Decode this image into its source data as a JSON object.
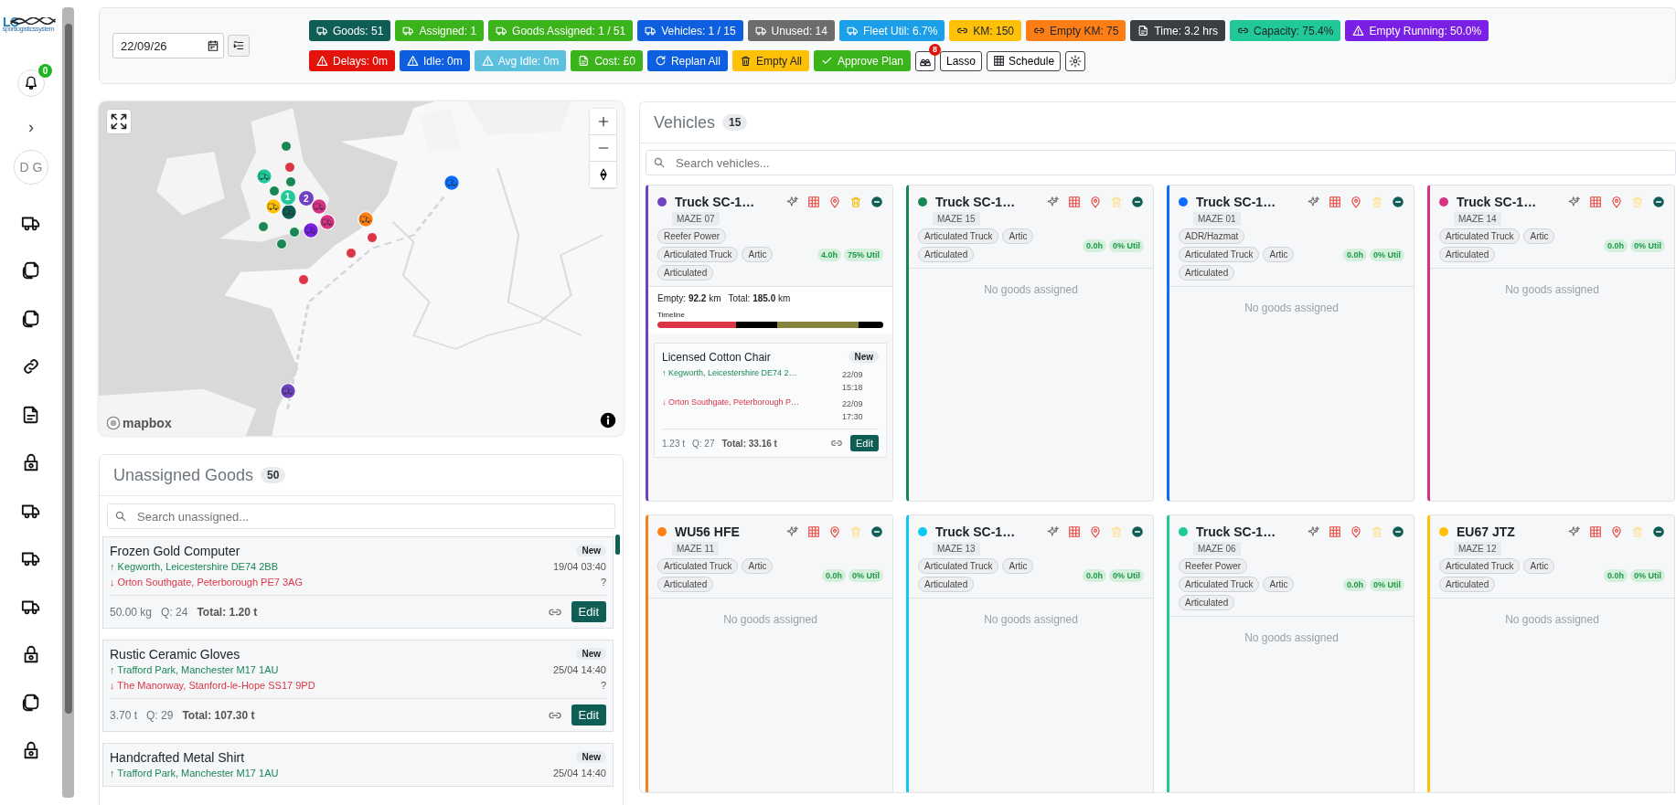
{
  "sidebar": {
    "logo": {
      "mark": "LS",
      "tagline": "sportlogisticssystem"
    },
    "notifications": "0",
    "expand": "›",
    "avatar": "D G"
  },
  "toolbar": {
    "date": "22/09/26",
    "summary": [
      {
        "kind": "vehicle",
        "label": "Goods: 51",
        "color": "#0f5e55",
        "dark_text": false
      },
      {
        "kind": "vehicle",
        "label": "Assigned: 1",
        "color": "#3bb31a",
        "dark_text": false
      },
      {
        "kind": "vehicle",
        "label": "Goods Assigned: 1 / 51",
        "color": "#3bb31a",
        "dark_text": false
      },
      {
        "kind": "vehicle",
        "label": "Vehicles: 1 / 15",
        "color": "#0d5fe0",
        "dark_text": false
      },
      {
        "kind": "vehicle",
        "label": "Unused: 14",
        "color": "#6c6c6c",
        "dark_text": false
      },
      {
        "kind": "vehicle",
        "label": "Fleet Util: 6.7%",
        "color": "#1a9fe8",
        "dark_text": false
      },
      {
        "kind": "distance",
        "label": "KM: 150",
        "color": "#ffc107",
        "dark_text": true
      },
      {
        "kind": "distance",
        "label": "Empty KM: 75",
        "color": "#fd7e14",
        "dark_text": true
      },
      {
        "kind": "time",
        "label": "Time: 3.2 hrs",
        "color": "#3a3f44",
        "dark_text": false
      },
      {
        "kind": "distance",
        "label": "Capacity: 75.4%",
        "color": "#20c997",
        "dark_text": true
      },
      {
        "kind": "alert",
        "label": "Empty Running: 50.0%",
        "color": "#7a1fe6",
        "dark_text": false
      }
    ],
    "alerts": [
      {
        "kind": "alert",
        "label": "Delays: 0m",
        "color": "#e3120b",
        "dark_text": false
      },
      {
        "kind": "alert",
        "label": "Idle: 0m",
        "color": "#0d5fe0",
        "dark_text": false
      },
      {
        "kind": "alert",
        "label": "Avg Idle: 0m",
        "color": "#5bc0de",
        "dark_text": false
      },
      {
        "kind": "time",
        "label": "Cost: £0",
        "color": "#3bb31a",
        "dark_text": false
      }
    ],
    "actions": [
      {
        "kind": "replan",
        "label": "Replan All",
        "color": "#0d5fe0",
        "dark_text": false
      },
      {
        "kind": "clear",
        "label": "Empty All",
        "color": "#ffc107",
        "dark_text": true
      },
      {
        "kind": "approve",
        "label": "Approve Plan",
        "color": "#3bb31a",
        "dark_text": false
      }
    ],
    "drivers_badge": "8",
    "lasso": "Lasso",
    "schedule": "Schedule"
  },
  "map": {
    "attribution": "mapbox",
    "markers": [
      {
        "kind": "dot",
        "color": "#198754"
      },
      {
        "kind": "dot",
        "color": "#dc3545"
      },
      {
        "kind": "dot",
        "color": "#198754"
      },
      {
        "kind": "truck",
        "color": "#20c997"
      },
      {
        "kind": "dot",
        "color": "#198754"
      },
      {
        "kind": "truck",
        "color": "#ffc107"
      },
      {
        "kind": "truck",
        "color": "#0f5e55"
      },
      {
        "kind": "cluster",
        "color": "#20c997",
        "label": "1"
      },
      {
        "kind": "cluster",
        "color": "#6f42c1",
        "label": "2"
      },
      {
        "kind": "truck",
        "color": "#d63384"
      },
      {
        "kind": "truck",
        "color": "#d63384"
      },
      {
        "kind": "dot",
        "color": "#198754"
      },
      {
        "kind": "dot",
        "color": "#198754"
      },
      {
        "kind": "truck",
        "color": "#7a1fe6"
      },
      {
        "kind": "dot",
        "color": "#198754"
      },
      {
        "kind": "truck",
        "color": "#fd7e14"
      },
      {
        "kind": "dot",
        "color": "#dc3545"
      },
      {
        "kind": "dot",
        "color": "#dc3545"
      },
      {
        "kind": "dot",
        "color": "#dc3545"
      },
      {
        "kind": "truck",
        "color": "#0d6efd"
      },
      {
        "kind": "truck",
        "color": "#6f42c1"
      }
    ]
  },
  "unassigned": {
    "title": "Unassigned Goods",
    "count": "50",
    "search_placeholder": "Search unassigned...",
    "items": [
      {
        "name": "Frozen Gold Computer",
        "status": "New",
        "pickup": "↑ Kegworth, Leicestershire DE74 2BB",
        "pickup_time": "19/04 03:40",
        "delivery": "↓ Orton Southgate, Peterborough PE7 3AG",
        "delivery_time": "?",
        "weight": "50.00 kg",
        "quantity": "Q: 24",
        "total": "Total: 1.20 t",
        "edit": "Edit"
      },
      {
        "name": "Rustic Ceramic Gloves",
        "status": "New",
        "pickup": "↑ Trafford Park, Manchester M17 1AU",
        "pickup_time": "25/04 14:40",
        "delivery": "↓ The Manorway, Stanford-le-Hope SS17 9PD",
        "delivery_time": "?",
        "weight": "3.70 t",
        "quantity": "Q: 29",
        "total": "Total: 107.30 t",
        "edit": "Edit"
      },
      {
        "name": "Handcrafted Metal Shirt",
        "status": "New",
        "pickup": "↑ Trafford Park, Manchester M17 1AU",
        "pickup_time": "25/04 14:40"
      }
    ]
  },
  "vehicles": {
    "title": "Vehicles",
    "count": "15",
    "search_placeholder": "Search vehicles...",
    "items": [
      {
        "name": "Truck SC-1…",
        "color": "#6f42c1",
        "code": "MAZE 07",
        "tag_rows": [
          [
            "Reefer Power"
          ],
          [
            "Articulated Truck",
            "Artic"
          ],
          [
            "Articulated"
          ]
        ],
        "hours": "4.0h",
        "util": "75% Util",
        "clear_disabled": false,
        "empty": "Empty: **92.2** km",
        "total": "Total: **185.0** km",
        "timeline_label": "Timeline",
        "goods": [
          {
            "name": "Licensed Cotton Chair",
            "status": "New",
            "pickup": "↑ Kegworth, Leicestershire DE74 2…",
            "pickup_time": "22/09 15:18",
            "delivery": "↓ Orton Southgate, Peterborough P…",
            "delivery_time": "22/09 17:30",
            "weight": "1.23 t",
            "quantity": "Q: 27",
            "total": "Total: 33.16 t",
            "edit": "Edit"
          }
        ]
      },
      {
        "name": "Truck SC-1…",
        "color": "#198754",
        "code": "MAZE 15",
        "tag_rows": [
          [
            "Articulated Truck",
            "Artic"
          ],
          [
            "Articulated"
          ]
        ],
        "hours": "0.0h",
        "util": "0% Util",
        "clear_disabled": true,
        "empty_text": "No goods assigned"
      },
      {
        "name": "Truck SC-1…",
        "color": "#0d6efd",
        "code": "MAZE 01",
        "tag_rows": [
          [
            "ADR/Hazmat"
          ],
          [
            "Articulated Truck",
            "Artic"
          ],
          [
            "Articulated"
          ]
        ],
        "hours": "0.0h",
        "util": "0% Util",
        "clear_disabled": true,
        "empty_text": "No goods assigned"
      },
      {
        "name": "Truck SC-1…",
        "color": "#d63384",
        "code": "MAZE 14",
        "tag_rows": [
          [
            "Articulated Truck",
            "Artic"
          ],
          [
            "Articulated"
          ]
        ],
        "hours": "0.0h",
        "util": "0% Util",
        "clear_disabled": true,
        "empty_text": "No goods assigned"
      },
      {
        "name": "WU56 HFE",
        "color": "#fd7e14",
        "code": "MAZE 11",
        "tag_rows": [
          [
            "Articulated Truck",
            "Artic"
          ],
          [
            "Articulated"
          ]
        ],
        "hours": "0.0h",
        "util": "0% Util",
        "clear_disabled": true,
        "empty_text": "No goods assigned"
      },
      {
        "name": "Truck SC-1…",
        "color": "#0dcaf0",
        "code": "MAZE 13",
        "tag_rows": [
          [
            "Articulated Truck",
            "Artic"
          ],
          [
            "Articulated"
          ]
        ],
        "hours": "0.0h",
        "util": "0% Util",
        "clear_disabled": true,
        "empty_text": "No goods assigned"
      },
      {
        "name": "Truck SC-1…",
        "color": "#20c997",
        "code": "MAZE 06",
        "tag_rows": [
          [
            "Reefer Power"
          ],
          [
            "Articulated Truck",
            "Artic"
          ],
          [
            "Articulated"
          ]
        ],
        "hours": "0.0h",
        "util": "0% Util",
        "clear_disabled": true,
        "empty_text": "No goods assigned"
      },
      {
        "name": "EU67 JTZ",
        "color": "#ffc107",
        "code": "MAZE 12",
        "tag_rows": [
          [
            "Articulated Truck",
            "Artic"
          ],
          [
            "Articulated"
          ]
        ],
        "hours": "0.0h",
        "util": "0% Util",
        "clear_disabled": true,
        "empty_text": "No goods assigned"
      }
    ]
  }
}
